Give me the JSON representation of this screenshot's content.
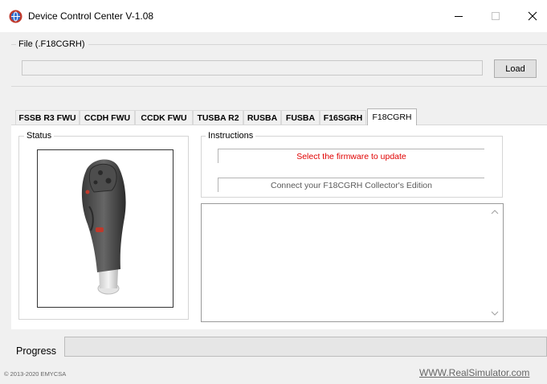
{
  "window": {
    "title": "Device Control Center V-1.08",
    "icon": "device-globe-icon",
    "controls": [
      "minimize-icon",
      "maximize-icon",
      "close-icon"
    ]
  },
  "file": {
    "legend": "File (.F18CGRH)",
    "path_value": "",
    "load_label": "Load"
  },
  "tabs": [
    {
      "label": "FSSB R3 FWU",
      "active": false
    },
    {
      "label": "CCDH FWU",
      "active": false
    },
    {
      "label": "CCDK FWU",
      "active": false
    },
    {
      "label": "TUSBA R2",
      "active": false
    },
    {
      "label": "RUSBA",
      "active": false
    },
    {
      "label": "FUSBA",
      "active": false
    },
    {
      "label": "F16SGRH",
      "active": false
    },
    {
      "label": "F18CGRH",
      "active": true
    }
  ],
  "status": {
    "legend": "Status",
    "image": "joystick-grip-image"
  },
  "instructions": {
    "legend": "Instructions",
    "line1": "Select the firmware to update",
    "line2": "Connect your F18CGRH Collector's Edition",
    "line1_color": "#e00000"
  },
  "log": {
    "text": ""
  },
  "progress": {
    "label": "Progress",
    "fraction": 0
  },
  "footer": {
    "copyright": "© 2013-2020 EMYCSA",
    "website": "WWW.RealSimulator.com"
  }
}
